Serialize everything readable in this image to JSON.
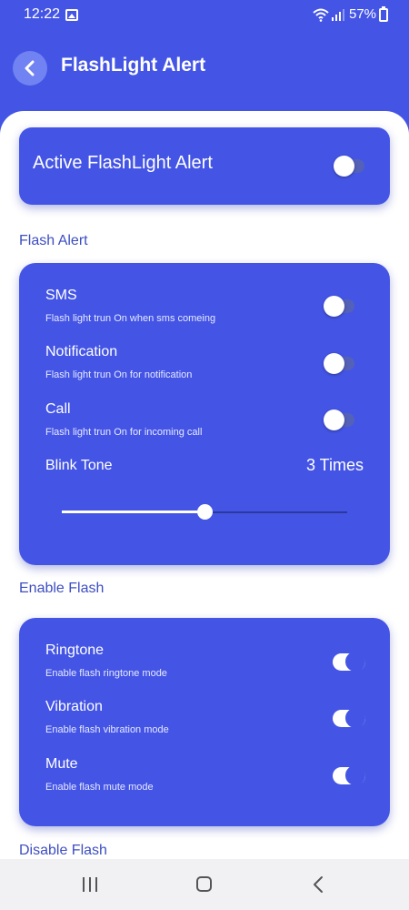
{
  "status_bar": {
    "time": "12:22",
    "battery": "57%"
  },
  "header": {
    "title": "FlashLight Alert"
  },
  "active": {
    "label": "Active FlashLight Alert",
    "enabled": false
  },
  "flash_alert": {
    "section_title": "Flash Alert",
    "rows": [
      {
        "title": "SMS",
        "subtitle": "Flash light trun On when sms comeing",
        "enabled": false
      },
      {
        "title": "Notification",
        "subtitle": "Flash light trun On for notification",
        "enabled": false
      },
      {
        "title": "Call",
        "subtitle": "Flash light trun On for incoming call",
        "enabled": false
      }
    ],
    "blink_tone": {
      "label": "Blink Tone",
      "value": "3 Times",
      "slider_fraction": 0.5
    }
  },
  "enable_flash": {
    "section_title": "Enable Flash",
    "rows": [
      {
        "title": "Ringtone",
        "subtitle": "Enable flash ringtone mode",
        "enabled": true
      },
      {
        "title": "Vibration",
        "subtitle": "Enable flash vibration mode",
        "enabled": true
      },
      {
        "title": "Mute",
        "subtitle": "Enable flash mute mode",
        "enabled": true
      }
    ]
  },
  "disable_flash": {
    "section_title": "Disable Flash"
  },
  "icons": {
    "back": "chevron-left-icon",
    "status_image": "image-icon",
    "wifi": "wifi-icon",
    "signal": "signal-icon",
    "battery": "battery-charging-icon",
    "nav_recents": "recents-icon",
    "nav_home": "home-icon",
    "nav_back": "back-icon"
  },
  "colors": {
    "primary": "#4455e6",
    "section_title": "#3d4ec2",
    "sheet": "#ffffff"
  }
}
